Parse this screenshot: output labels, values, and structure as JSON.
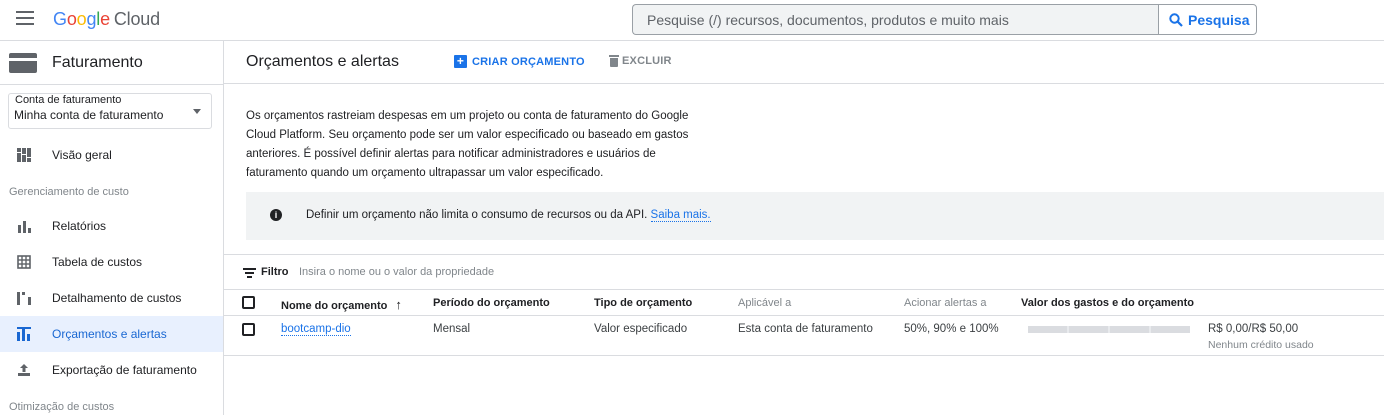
{
  "app": {
    "brand_letters": [
      "G",
      "o",
      "o",
      "g",
      "l",
      "e"
    ],
    "brand_suffix": "Cloud",
    "search_placeholder": "Pesquise (/) recursos, documentos, produtos e muito mais",
    "search_button": "Pesquisa"
  },
  "sidebar": {
    "title": "Faturamento",
    "account_label": "Conta de faturamento",
    "account_value": "Minha conta de faturamento",
    "items": [
      {
        "label": "Visão geral",
        "icon": "dashboard-icon"
      },
      {
        "label": "Relatórios",
        "icon": "bar-chart-icon"
      },
      {
        "label": "Tabela de custos",
        "icon": "table-icon"
      },
      {
        "label": "Detalhamento de custos",
        "icon": "breakdown-icon"
      },
      {
        "label": "Orçamentos e alertas",
        "icon": "budget-icon",
        "active": true
      },
      {
        "label": "Exportação de faturamento",
        "icon": "export-icon"
      }
    ],
    "sections": [
      "Gerenciamento de custo",
      "Otimização de custos"
    ]
  },
  "main": {
    "title": "Orçamentos e alertas",
    "create_label": "CRIAR ORÇAMENTO",
    "delete_label": "EXCLUIR",
    "description": "Os orçamentos rastreiam despesas em um projeto ou conta de faturamento do Google Cloud Platform. Seu orçamento pode ser um valor especificado ou baseado em gastos anteriores. É possível definir alertas para notificar administradores e usuários de faturamento quando um orçamento ultrapassar um valor especificado.",
    "info_text": "Definir um orçamento não limita o consumo de recursos ou da API.",
    "info_link": "Saiba mais.",
    "filter_label": "Filtro",
    "filter_placeholder": "Insira o nome ou o valor da propriedade"
  },
  "table": {
    "columns": [
      "Nome do orçamento",
      "Período do orçamento",
      "Tipo de orçamento",
      "Aplicável a",
      "Acionar alertas a",
      "Valor dos gastos e do orçamento"
    ],
    "sort_arrow": "↑",
    "rows": [
      {
        "name": "bootcamp-dio",
        "period": "Mensal",
        "type": "Valor especificado",
        "applies_to": "Esta conta de faturamento",
        "alerts": "50%, 90% e 100%",
        "spend_fraction": 0.0,
        "amount": "R$ 0,00/R$ 50,00",
        "note": "Nenhum crédito usado"
      }
    ]
  },
  "colors": {
    "accent": "#1a73e8",
    "active_bg": "#e8f0fe",
    "info_bg": "#f1f3f4"
  }
}
